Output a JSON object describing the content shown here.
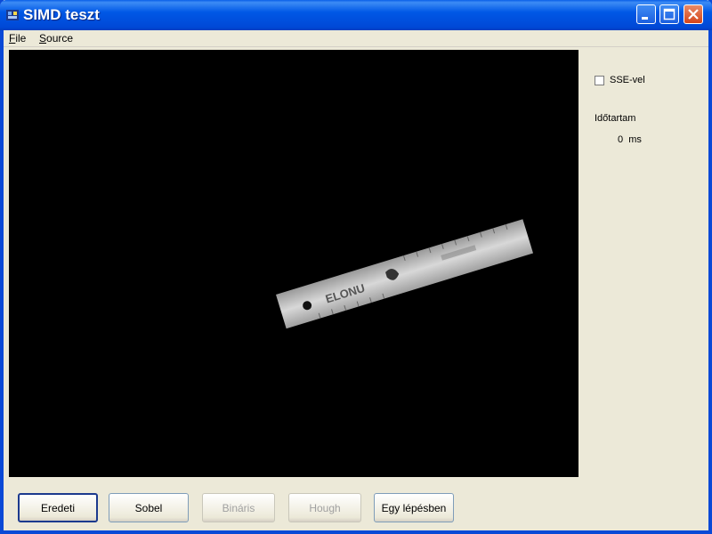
{
  "window": {
    "title": "SIMD teszt"
  },
  "menu": {
    "items": [
      {
        "label": "File",
        "accel": "F",
        "rest": "ile"
      },
      {
        "label": "Source",
        "accel": "S",
        "rest": "ource"
      }
    ]
  },
  "options": {
    "sse_label": "SSE-vel",
    "sse_checked": false
  },
  "timing": {
    "label": "Időtartam",
    "value": "0",
    "unit": "ms"
  },
  "buttons": [
    {
      "label": "Eredeti",
      "enabled": true,
      "default": true
    },
    {
      "label": "Sobel",
      "enabled": true
    },
    {
      "label": "Bináris",
      "enabled": false
    },
    {
      "label": "Hough",
      "enabled": false
    },
    {
      "label": "Egy lépésben",
      "enabled": true
    }
  ],
  "image": {
    "subject": "ruler on black background",
    "ruler_text": "ELONU"
  }
}
